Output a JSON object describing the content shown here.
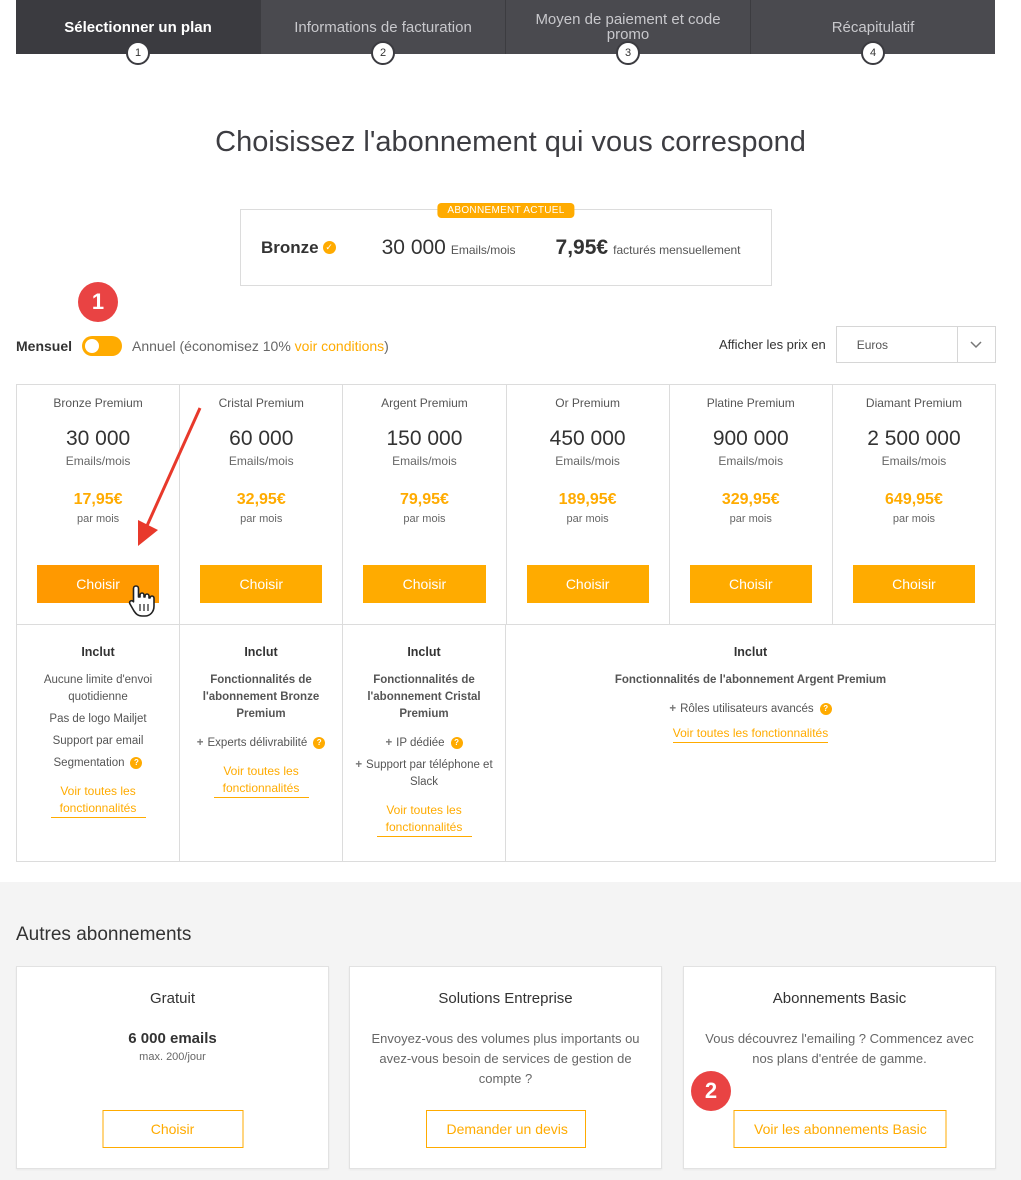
{
  "stepper": {
    "steps": [
      {
        "label": "Sélectionner un plan",
        "num": "1"
      },
      {
        "label": "Informations de facturation",
        "num": "2"
      },
      {
        "label": "Moyen de paiement et code promo",
        "num": "3"
      },
      {
        "label": "Récapitulatif",
        "num": "4"
      }
    ]
  },
  "main": {
    "title": "Choisissez l'abonnement qui vous correspond"
  },
  "current_plan": {
    "badge": "ABONNEMENT ACTUEL",
    "name": "Bronze",
    "volume": "30 000",
    "volume_unit": "Emails/mois",
    "price": "7,95€",
    "price_note": "facturés mensuellement"
  },
  "annotations": {
    "one": "1",
    "two": "2"
  },
  "billing": {
    "monthly": "Mensuel",
    "annual": "Annuel (économisez 10%",
    "conditions": "voir conditions",
    "close": ")"
  },
  "currency": {
    "label": "Afficher les prix en",
    "value": "Euros"
  },
  "plans": [
    {
      "name": "Bronze Premium",
      "volume": "30 000",
      "unit": "Emails/mois",
      "price": "17,95€",
      "per": "par mois",
      "cta": "Choisir"
    },
    {
      "name": "Cristal Premium",
      "volume": "60 000",
      "unit": "Emails/mois",
      "price": "32,95€",
      "per": "par mois",
      "cta": "Choisir"
    },
    {
      "name": "Argent Premium",
      "volume": "150 000",
      "unit": "Emails/mois",
      "price": "79,95€",
      "per": "par mois",
      "cta": "Choisir"
    },
    {
      "name": "Or Premium",
      "volume": "450 000",
      "unit": "Emails/mois",
      "price": "189,95€",
      "per": "par mois",
      "cta": "Choisir"
    },
    {
      "name": "Platine Premium",
      "volume": "900 000",
      "unit": "Emails/mois",
      "price": "329,95€",
      "per": "par mois",
      "cta": "Choisir"
    },
    {
      "name": "Diamant Premium",
      "volume": "2 500 000",
      "unit": "Emails/mois",
      "price": "649,95€",
      "per": "par mois",
      "cta": "Choisir"
    }
  ],
  "includes": {
    "title": "Inclut",
    "see_all": "Voir toutes les fonctionnalités",
    "bronze": {
      "items": [
        "Aucune limite d'envoi quotidienne",
        "Pas de logo Mailjet",
        "Support par email",
        "Segmentation"
      ]
    },
    "cristal": {
      "sub": "Fonctionnalités de l'abonnement Bronze Premium",
      "items": [
        "Experts délivrabilité"
      ]
    },
    "argent": {
      "sub": "Fonctionnalités de l'abonnement Cristal Premium",
      "items": [
        "IP dédiée",
        "Support par téléphone et Slack"
      ]
    },
    "or": {
      "sub": "Fonctionnalités de l'abonnement Argent Premium",
      "items": [
        "Rôles utilisateurs avancés"
      ]
    }
  },
  "others": {
    "title": "Autres abonnements",
    "cards": [
      {
        "title": "Gratuit",
        "big": "6 000 emails",
        "small": "max. 200/jour",
        "cta": "Choisir"
      },
      {
        "title": "Solutions Entreprise",
        "desc": "Envoyez-vous des volumes plus importants ou avez-vous besoin de services de gestion de compte ?",
        "cta": "Demander un devis"
      },
      {
        "title": "Abonnements Basic",
        "desc": "Vous découvrez l'emailing ? Commencez avec nos plans d'entrée de gamme.",
        "cta": "Voir les abonnements Basic"
      }
    ]
  },
  "colors": {
    "accent": "#ffab00",
    "header": "#4a4a4f",
    "annotation": "#e94343"
  }
}
